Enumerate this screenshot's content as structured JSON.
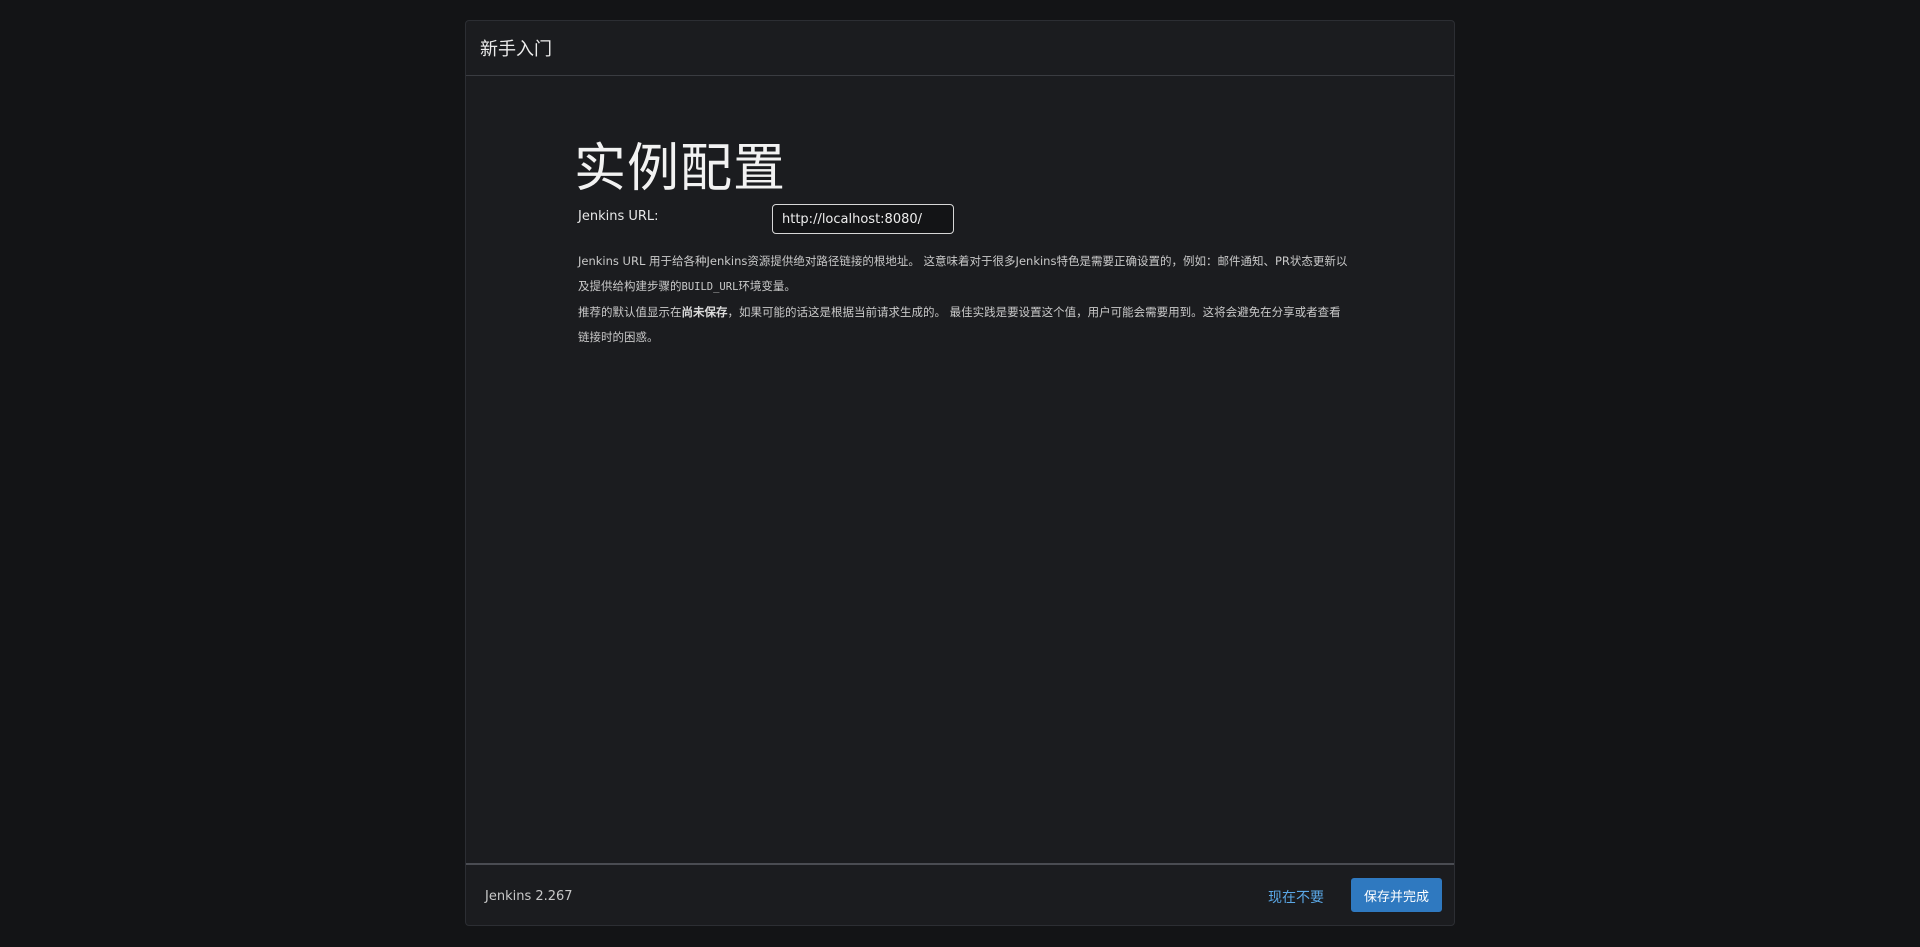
{
  "dialog": {
    "title": "新手入门"
  },
  "page": {
    "heading": "实例配置"
  },
  "jenkins_url": {
    "label": "Jenkins URL:",
    "value": "http://localhost:8080/"
  },
  "help": {
    "line1_part1": "Jenkins URL 用于给各种Jenkins资源提供绝对路径链接的根地址。 这意味着对于很多Jenkins特色是需要正确设置的，例如：邮件通知、PR状态更新以及提供给构建步骤的",
    "line1_code": "BUILD_URL",
    "line1_part2": "环境变量。",
    "line2_part1": "推荐的默认值显示在",
    "line2_strong": "尚未保存",
    "line2_part2": "，如果可能的话这是根据当前请求生成的。 最佳实践是要设置这个值，用户可能会需要用到。这将会避免在分享或者查看链接时的困惑。"
  },
  "footer": {
    "version": "Jenkins 2.267",
    "skip_label": "现在不要",
    "save_label": "保存并完成"
  },
  "colors": {
    "background": "#131416",
    "panel": "#1b1c1f",
    "primary_button": "#2f79c0",
    "link": "#5aa7e6"
  }
}
